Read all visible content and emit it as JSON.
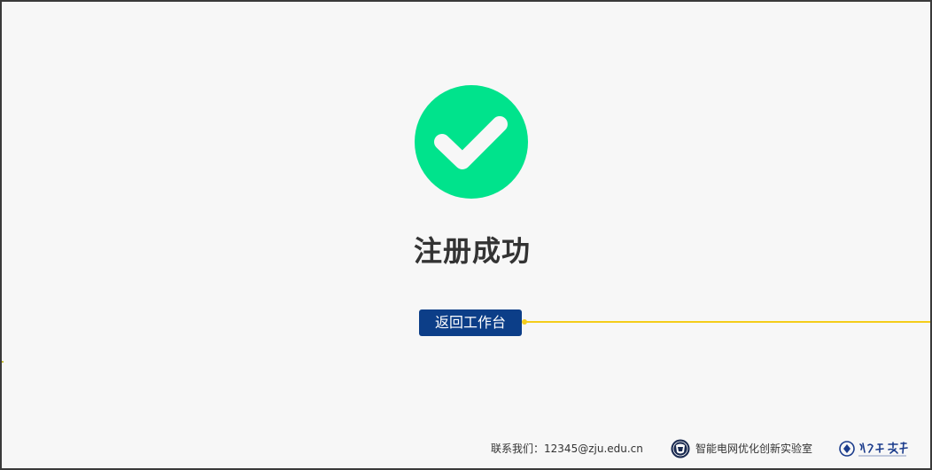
{
  "status": {
    "icon": "check-circle-icon",
    "title": "注册成功"
  },
  "actions": {
    "return_label": "返回工作台"
  },
  "footer": {
    "contact_label": "联系我们",
    "contact_separator": "：",
    "contact_email": "12345@zju.edu.cn",
    "lab_name": "智能电网优化创新实验室",
    "lab_logo": "lab-logo-icon",
    "university_logo": "zhejiang-university-logo"
  },
  "colors": {
    "success": "#00e38c",
    "button_bg": "#0c3e88",
    "connector": "#f4cd1a",
    "background": "#f7f7f7"
  }
}
